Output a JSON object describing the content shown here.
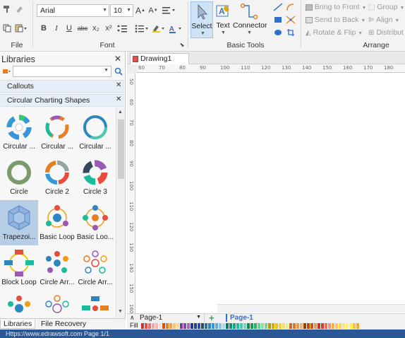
{
  "ribbon": {
    "font_name": "Arial",
    "font_size": "10",
    "groups": {
      "file": "File",
      "font": "Font",
      "basic_tools": "Basic Tools",
      "arrange": "Arrange"
    },
    "tools": {
      "select": "Select",
      "text": "Text",
      "connector": "Connector"
    },
    "arrange": {
      "bring_to_front": "Bring to Front",
      "send_to_back": "Send to Back",
      "rotate_flip": "Rotate & Flip",
      "group": "Group",
      "align": "Align",
      "distribute": "Distribut"
    },
    "format_buttons": [
      "B",
      "I",
      "U",
      "abc",
      "x₂",
      "x²"
    ]
  },
  "libraries": {
    "title": "Libraries",
    "search_value": "",
    "sections": [
      "Callouts",
      "Circular Charting Shapes"
    ],
    "shapes": [
      {
        "label": "Circular ..."
      },
      {
        "label": "Circular ..."
      },
      {
        "label": "Circular ..."
      },
      {
        "label": "Circle"
      },
      {
        "label": "Circle 2"
      },
      {
        "label": "Circle 3"
      },
      {
        "label": "Trapezoi..."
      },
      {
        "label": "Basic Loop"
      },
      {
        "label": "Basic Loo..."
      },
      {
        "label": "Block Loop"
      },
      {
        "label": "Circle Arr..."
      },
      {
        "label": "Circle Arr..."
      },
      {
        "label": ""
      },
      {
        "label": ""
      },
      {
        "label": ""
      }
    ],
    "tabs": [
      "Libraries",
      "File Recovery"
    ]
  },
  "document": {
    "tab_title": "Drawing1",
    "ruler_h": [
      "60",
      "70",
      "80",
      "90",
      "100",
      "110",
      "120",
      "130",
      "140",
      "150",
      "160",
      "170",
      "180"
    ],
    "ruler_v": [
      "50",
      "60",
      "70",
      "80",
      "90",
      "100",
      "110",
      "120",
      "130",
      "140",
      "150",
      "160"
    ]
  },
  "pages": {
    "selector": "Page-1",
    "active_tab": "Page-1",
    "add_symbol": "+"
  },
  "palette": {
    "label": "Fill",
    "colors": [
      "#c0392b",
      "#e74c3c",
      "#e8717a",
      "#f1a9a0",
      "#f5b7b1",
      "#fadbd8",
      "#d35400",
      "#e67e22",
      "#f0a04b",
      "#f8c471",
      "#fad7a0",
      "#7d3c98",
      "#8e44ad",
      "#a569bd",
      "#1f3a93",
      "#2c3e8f",
      "#2e4e9e",
      "#34495e",
      "#2874a6",
      "#2e86c1",
      "#3498db",
      "#5dade2",
      "#85c1e9",
      "#aed6f1",
      "#117864",
      "#148f77",
      "#17a589",
      "#1abc9c",
      "#48c9b0",
      "#76d7c4",
      "#1e8449",
      "#239b56",
      "#28b463",
      "#58d68d",
      "#82e0aa",
      "#7dcea0",
      "#b7950b",
      "#d4ac0d",
      "#f1c40f",
      "#f4d03f",
      "#f7dc6f",
      "#f9e79f",
      "#ca6f1e",
      "#dc7633",
      "#eb984e",
      "#f0b27a",
      "#a04000",
      "#ba4a00",
      "#d35400",
      "#e59866",
      "#c0392b",
      "#cb4335",
      "#ec7063",
      "#f1948a",
      "#f5b041",
      "#f8c471",
      "#ffd54f",
      "#ffe082",
      "#fff176",
      "#ffee58",
      "#fbc02d",
      "#f9a825"
    ]
  },
  "status": {
    "text": "Https://www.edrawsoft.com   Page 1/1"
  },
  "accent": "#2b5797"
}
